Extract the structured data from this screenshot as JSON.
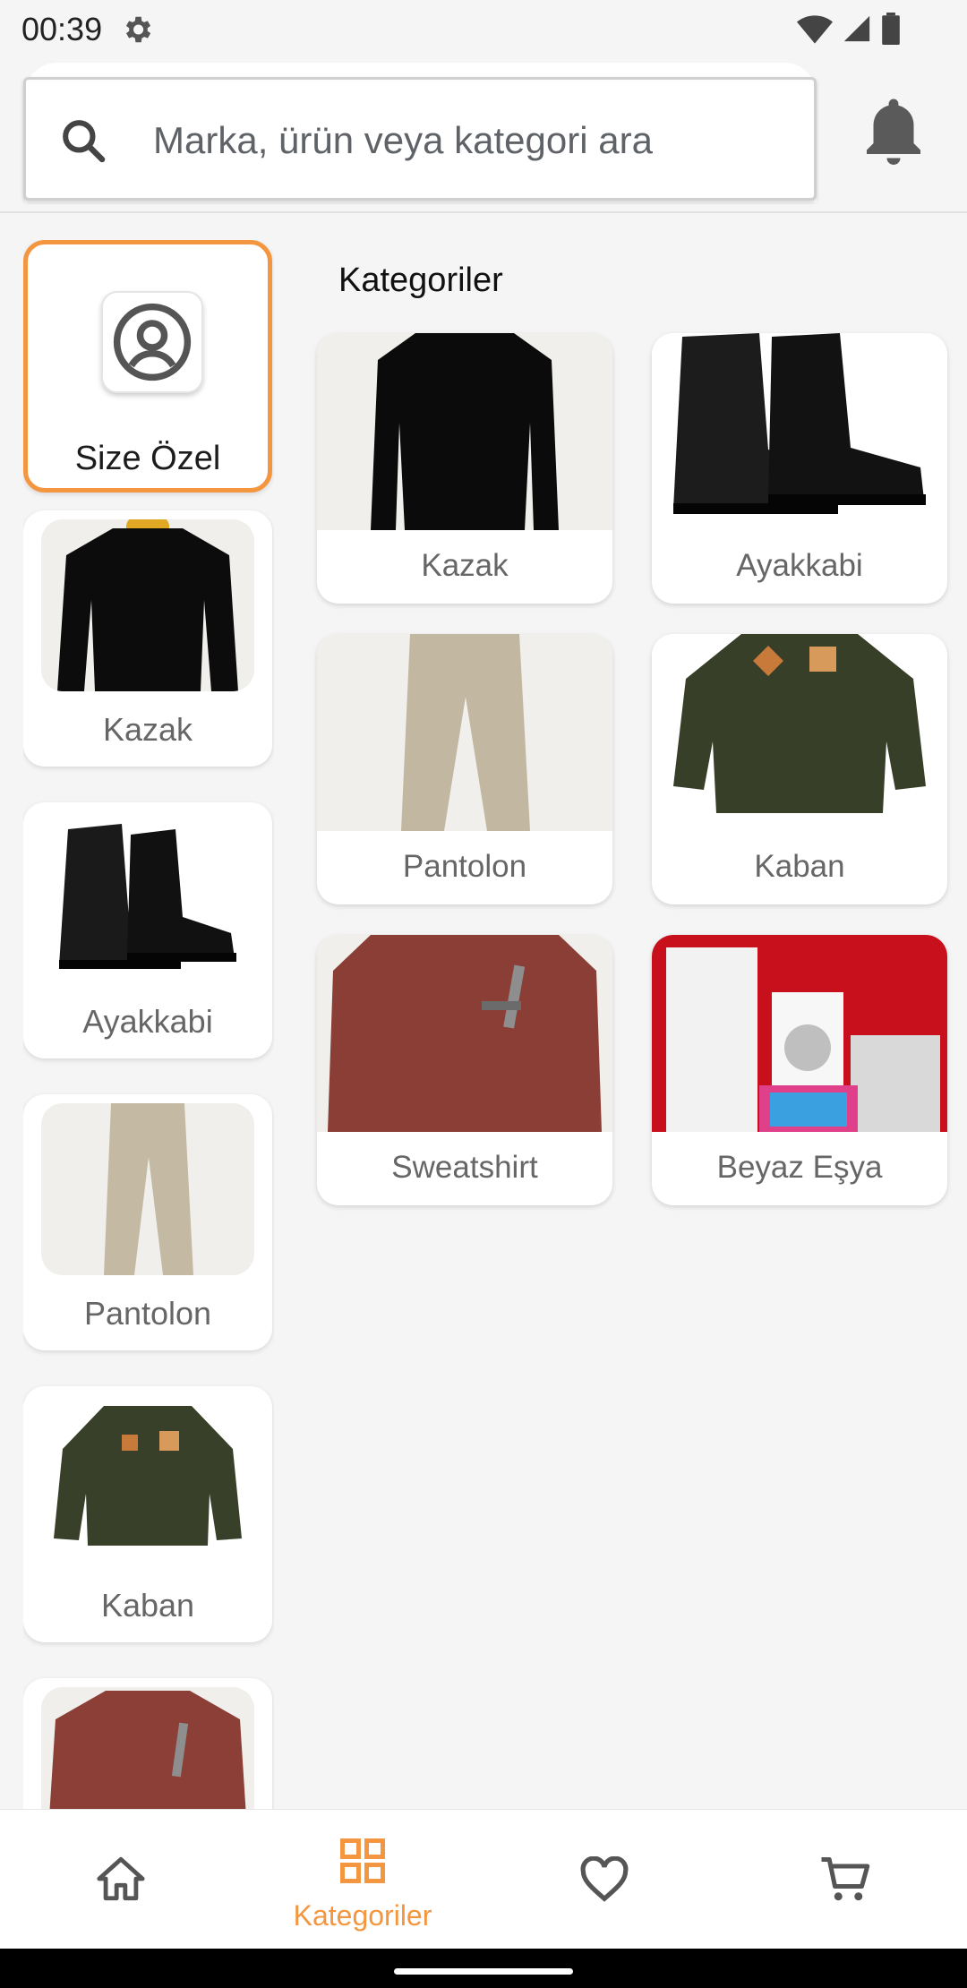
{
  "status_bar": {
    "time": "00:39"
  },
  "search": {
    "placeholder": "Marka, ürün veya kategori ara"
  },
  "sidebar": {
    "featured_label": "Size Özel",
    "items": [
      {
        "label": "Kazak",
        "icon": "sweater-image"
      },
      {
        "label": "Ayakkabi",
        "icon": "boots-image"
      },
      {
        "label": "Pantolon",
        "icon": "trousers-image"
      },
      {
        "label": "Kaban",
        "icon": "coat-image"
      },
      {
        "label": "",
        "icon": "sweatshirt-image"
      }
    ]
  },
  "main": {
    "title": "Kategoriler",
    "categories": [
      {
        "label": "Kazak",
        "icon": "sweater-image"
      },
      {
        "label": "Ayakkabi",
        "icon": "boots-image"
      },
      {
        "label": "Pantolon",
        "icon": "trousers-image"
      },
      {
        "label": "Kaban",
        "icon": "coat-image"
      },
      {
        "label": "Sweatshirt",
        "icon": "sweatshirt-image"
      },
      {
        "label": "Beyaz Eşya",
        "icon": "appliances-image"
      }
    ]
  },
  "bottom_nav": {
    "items": [
      {
        "icon": "home-icon",
        "label": ""
      },
      {
        "icon": "grid-icon",
        "label": "Kategoriler",
        "active": true
      },
      {
        "icon": "heart-icon",
        "label": ""
      },
      {
        "icon": "cart-icon",
        "label": ""
      }
    ]
  },
  "colors": {
    "accent": "#f4963f",
    "background": "#f5f5f5",
    "card": "#ffffff"
  }
}
